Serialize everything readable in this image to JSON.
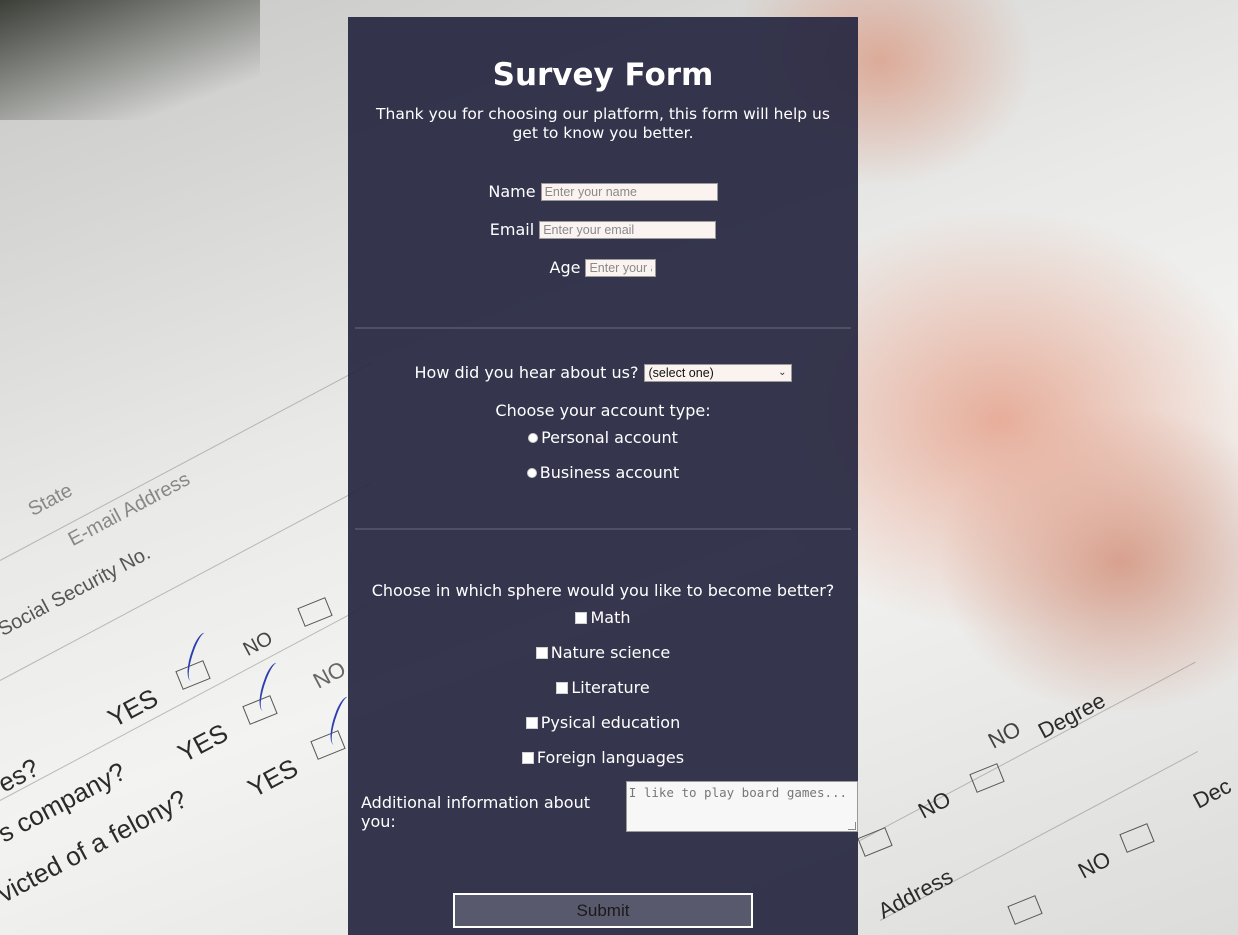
{
  "form": {
    "title": "Survey Form",
    "description": "Thank you for choosing our platform, this form will help us get to know you better.",
    "fields": {
      "name": {
        "label": "Name",
        "placeholder": "Enter your name"
      },
      "email": {
        "label": "Email",
        "placeholder": "Enter your email"
      },
      "age": {
        "label": "Age",
        "placeholder": "Enter your age"
      }
    },
    "referral": {
      "label": "How did you hear about us?",
      "selected": "(select one)"
    },
    "account_type": {
      "question": "Choose your account type:",
      "options": [
        "Personal account",
        "Business account"
      ]
    },
    "spheres": {
      "question": "Choose in which sphere would you like to become better?",
      "options": [
        "Math",
        "Nature science",
        "Literature",
        "Pysical education",
        "Foreign languages"
      ]
    },
    "additional_info": {
      "label": "Additional information about you:",
      "placeholder": "I like to play board games..."
    },
    "submit_label": "Submit"
  },
  "background": {
    "form_words": [
      "State",
      "E-mail Address",
      "Social Security No.",
      "NO",
      "YES",
      "NO",
      "YES",
      "NO",
      "YES",
      "es?",
      "s company?",
      "victed of a felony?",
      "Degree",
      "NO",
      "NO",
      "Address",
      "Dec"
    ]
  },
  "colors": {
    "panel": "#272842",
    "input_bg": "#fbf3f0",
    "text": "#ffffff"
  }
}
